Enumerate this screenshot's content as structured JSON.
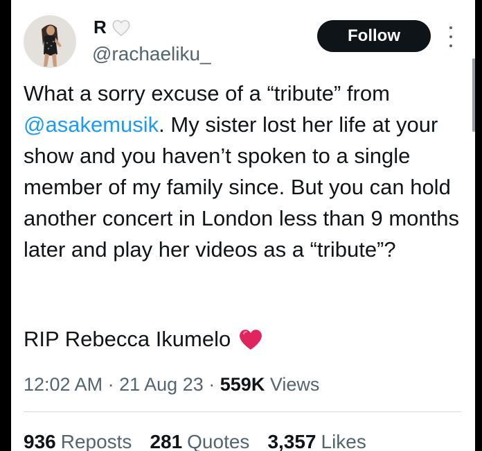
{
  "author": {
    "display_name": "R",
    "handle": "@rachaeliku_",
    "avatar_icon": "profile-photo"
  },
  "header": {
    "follow_label": "Follow",
    "more_icon": "more-vertical-icon"
  },
  "tweet": {
    "text_before_mention": "What a sorry excuse of a “tribute” from ",
    "mention": "@asakemusik",
    "text_after_mention": ". My sister lost her life at your show and you haven’t spoken to a single member of my family since. But you can hold another concert in London less than 9 months later and play her videos as a “tribute”?",
    "rip_text": "RIP Rebecca Ikumelo"
  },
  "meta": {
    "time": "12:02 AM",
    "separator": "·",
    "date": "21 Aug 23",
    "views_count": "559K",
    "views_label": "Views"
  },
  "stats": {
    "reposts_count": "936",
    "reposts_label": "Reposts",
    "quotes_count": "281",
    "quotes_label": "Quotes",
    "likes_count": "3,357",
    "likes_label": "Likes"
  },
  "colors": {
    "link": "#1d9bf0",
    "text": "#0f1419",
    "secondary": "#536471",
    "heart": "#e0245e",
    "button_bg": "#0f1419"
  }
}
